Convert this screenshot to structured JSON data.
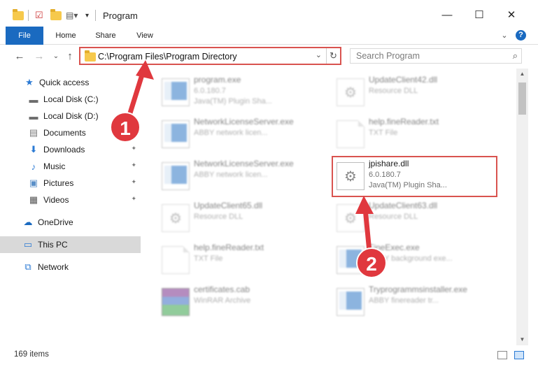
{
  "window": {
    "title": "Program",
    "minimize": "—",
    "maximize": "☐",
    "close": "✕"
  },
  "ribbon": {
    "tabs": [
      "File",
      "Home",
      "Share",
      "View"
    ],
    "expand": "⌄",
    "help": "?"
  },
  "nav": {
    "back": "←",
    "forward": "→",
    "recent": "⌄",
    "up": "↑",
    "address": "C:\\Program Files\\Program Directory",
    "address_dropdown": "⌄",
    "refresh": "↻",
    "search_placeholder": "Search Program",
    "search_icon": "⌕"
  },
  "sidebar": {
    "items": [
      {
        "label": "Quick access",
        "icon": "star-icon",
        "glyph": "★",
        "color": "#2b7ad4"
      },
      {
        "label": "Local Disk (C:)",
        "icon": "drive-icon",
        "glyph": "▬",
        "color": "#6d6d6d",
        "pinned": true
      },
      {
        "label": "Local Disk (D:)",
        "icon": "drive-icon",
        "glyph": "▬",
        "color": "#6d6d6d",
        "pinned": true
      },
      {
        "label": "Documents",
        "icon": "documents-icon",
        "glyph": "▤",
        "color": "#7a7a7a",
        "pinned": true
      },
      {
        "label": "Downloads",
        "icon": "download-icon",
        "glyph": "⬇",
        "color": "#2b7ad4",
        "pinned": true
      },
      {
        "label": "Music",
        "icon": "music-icon",
        "glyph": "♪",
        "color": "#2b7ad4",
        "pinned": true
      },
      {
        "label": "Pictures",
        "icon": "pictures-icon",
        "glyph": "▣",
        "color": "#5a8fc8",
        "pinned": true
      },
      {
        "label": "Videos",
        "icon": "videos-icon",
        "glyph": "▦",
        "color": "#555555",
        "pinned": true
      },
      {
        "label": "OneDrive",
        "icon": "cloud-icon",
        "glyph": "☁",
        "color": "#1a6ac0"
      },
      {
        "label": "This PC",
        "icon": "computer-icon",
        "glyph": "▭",
        "color": "#2b7ad4",
        "selected": true
      },
      {
        "label": "Network",
        "icon": "network-icon",
        "glyph": "⧉",
        "color": "#2b7ad4"
      }
    ],
    "pin_glyph": "📌"
  },
  "files": [
    {
      "name": "program.exe",
      "line2": "6.0.180.7",
      "line3": "Java(TM) Plugin Sha...",
      "icon": "exe"
    },
    {
      "name": "UpdateClient42.dll",
      "line2": "Resource DLL",
      "line3": "",
      "icon": "gear"
    },
    {
      "name": "NetworkLicenseServer.exe",
      "line2": "ABBY network licen...",
      "line3": "",
      "icon": "window"
    },
    {
      "name": "help.fineReader.txt",
      "line2": "TXT File",
      "line3": "",
      "icon": "doc"
    },
    {
      "name": "NetworkLicenseServer.exe",
      "line2": "ABBY network licen...",
      "line3": "",
      "icon": "window"
    },
    {
      "name": "jpishare.dll",
      "line2": "6.0.180.7",
      "line3": "Java(TM) Plugin Sha...",
      "icon": "gear",
      "highlighted": true
    },
    {
      "name": "UpdateClient65.dll",
      "line2": "Resource DLL",
      "line3": "",
      "icon": "gear"
    },
    {
      "name": "UpdateClient63.dll",
      "line2": "Resource DLL",
      "line3": "",
      "icon": "gear"
    },
    {
      "name": "help.fineReader.txt",
      "line2": "TXT File",
      "line3": "",
      "icon": "doc"
    },
    {
      "name": "FineExec.exe",
      "line2": "ABBY background exe...",
      "line3": "",
      "icon": "window"
    },
    {
      "name": "certificates.cab",
      "line2": "WinRAR Archive",
      "line3": "",
      "icon": "rar"
    },
    {
      "name": "Tryprogrammsinstaller.exe",
      "line2": "ABBY finereader tr...",
      "line3": "",
      "icon": "window"
    }
  ],
  "status": {
    "count": "169 items"
  },
  "annotations": {
    "step1": "1",
    "step2": "2",
    "color": "#e0383e"
  }
}
